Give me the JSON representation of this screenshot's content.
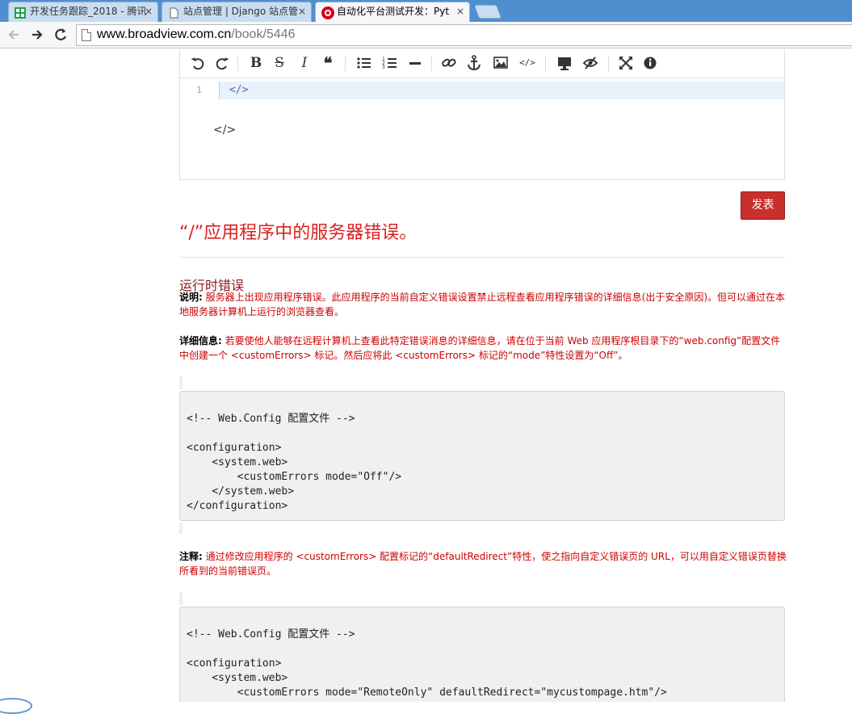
{
  "browser": {
    "tabs": [
      {
        "title": "开发任务跟踪_2018 - 腾讯",
        "icon": "spreadsheet-icon"
      },
      {
        "title": "站点管理 | Django 站点管",
        "icon": "page-icon"
      },
      {
        "title": "自动化平台测试开发：Pyt",
        "icon": "site-logo-icon"
      }
    ],
    "close_glyph": "×",
    "url_host": "www.broadview.com.cn",
    "url_path": "/book/5446"
  },
  "editor": {
    "line_number": "1",
    "line_content": "</>",
    "preview_text": "</>"
  },
  "publish_label": "发表",
  "error": {
    "title": "“/”应用程序中的服务器错误。",
    "subtitle": "运行时错误",
    "desc_label": "说明:",
    "desc_text": " 服务器上出现应用程序错误。此应用程序的当前自定义错误设置禁止远程查看应用程序错误的详细信息(出于安全原因)。但可以通过在本地服务器计算机上运行的浏览器查看。",
    "detail_label": "详细信息:",
    "detail_text": " 若要使他人能够在远程计算机上查看此特定错误消息的详细信息，请在位于当前 Web 应用程序根目录下的“web.config”配置文件中创建一个 <customErrors> 标记。然后应将此 <customErrors> 标记的“mode”特性设置为“Off”。",
    "code1": "\n<!-- Web.Config 配置文件 -->\n\n<configuration>\n    <system.web>\n        <customErrors mode=\"Off\"/>\n    </system.web>\n</configuration>",
    "note_label": "注释:",
    "note_text": " 通过修改应用程序的 <customErrors> 配置标记的“defaultRedirect”特性，使之指向自定义错误页的 URL，可以用自定义错误页替换所看到的当前错误页。",
    "code2": "\n<!-- Web.Config 配置文件 -->\n\n<configuration>\n    <system.web>\n        <customErrors mode=\"RemoteOnly\" defaultRedirect=\"mycustompage.htm\"/>"
  },
  "colors": {
    "error_red": "#dc2020",
    "publish_bg": "#c9302c",
    "tabbar": "#4f8fd0"
  }
}
